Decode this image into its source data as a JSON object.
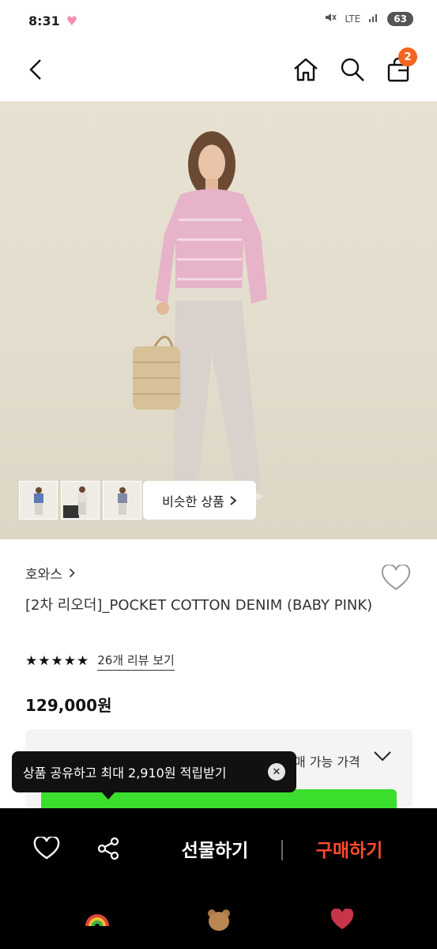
{
  "status_bar": {
    "time": "8:31",
    "network": "LTE",
    "battery": "63"
  },
  "nav": {
    "cart_count": "2"
  },
  "gallery": {
    "similar_label": "비슷한 상품"
  },
  "product": {
    "brand": "호와스",
    "title": "[2차 리오더]_POCKET COTTON DENIM (BABY PINK)",
    "stars": "★★★★★",
    "review_link": "26개 리뷰 보기",
    "price": "129,000원",
    "price_box_label": "매 가능 가격"
  },
  "tooltip": {
    "text": "상품 공유하고 최대 2,910원 적립받기"
  },
  "bottom_bar": {
    "gift_label": "선물하기",
    "buy_label": "구매하기"
  },
  "colors": {
    "accent_orange": "#f26522",
    "buy_red": "#ff4a2d",
    "banner_green": "#3bde2c"
  }
}
